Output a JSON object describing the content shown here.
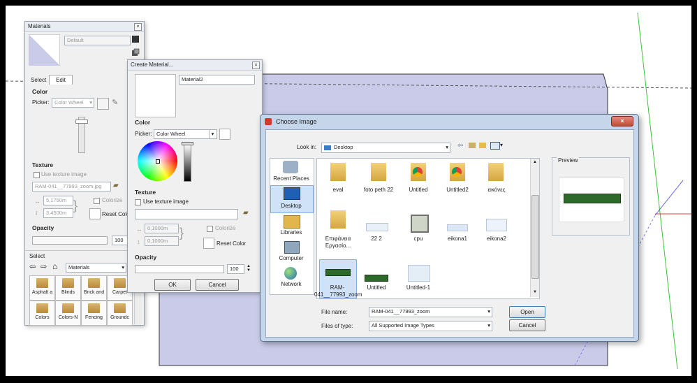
{
  "materials": {
    "title": "Materials",
    "default_name": "Default",
    "tab_select": "Select",
    "tab_edit": "Edit",
    "color_heading": "Color",
    "picker_label": "Picker:",
    "picker_value": "Color Wheel",
    "texture_heading": "Texture",
    "use_texture": "Use texture image",
    "texture_file": "RAM-041__77993_zoom.jpg",
    "width_value": "5,1750m",
    "height_value": "3,4500m",
    "colorize": "Colorize",
    "reset_color": "Reset Color",
    "opacity_heading": "Opacity",
    "opacity_value": "100",
    "select_heading": "Select",
    "collection": "Materials",
    "tiles": [
      "Asphalt a",
      "Blinds",
      "Brick and",
      "Carpet",
      "Colors",
      "Colors-N",
      "Fencing",
      "Groundc"
    ]
  },
  "create": {
    "title": "Create Material...",
    "name_value": "Material2",
    "color_heading": "Color",
    "picker_label": "Picker:",
    "picker_value": "Color Wheel",
    "texture_heading": "Texture",
    "use_texture": "Use texture image",
    "width_value": "0,1000m",
    "height_value": "0,1000m",
    "colorize": "Colorize",
    "reset_color": "Reset Color",
    "opacity_heading": "Opacity",
    "opacity_value": "100",
    "ok": "OK",
    "cancel": "Cancel"
  },
  "choose": {
    "title": "Choose Image",
    "look_in_label": "Look in:",
    "look_in_value": "Desktop",
    "preview_label": "Preview",
    "places": [
      "Recent Places",
      "Desktop",
      "Libraries",
      "Computer",
      "Network"
    ],
    "files": [
      "eval",
      "foto peth 22",
      "Untitled",
      "Untitled2",
      "εικόνες",
      "Επιφάνεια Εργασίο...",
      "22 2",
      "cpu",
      "eikona1",
      "eikona2",
      "RAM-041__77993_zoom",
      "Untitled",
      "Untitled-1"
    ],
    "filename_label": "File name:",
    "filename_value": "RAM-041__77993_zoom",
    "filetype_label": "Files of type:",
    "filetype_value": "All Supported Image Types",
    "open": "Open",
    "cancel": "Cancel"
  }
}
